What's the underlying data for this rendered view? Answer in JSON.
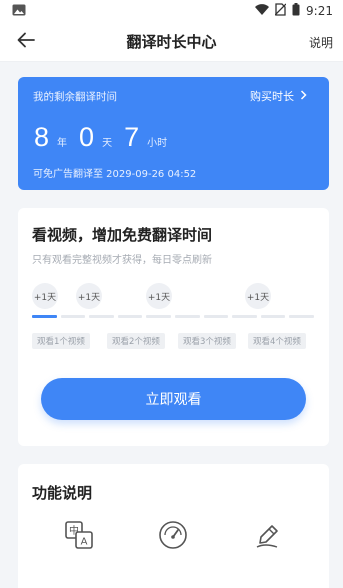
{
  "status_bar": {
    "time": "9:21"
  },
  "header": {
    "title": "翻译时长中心",
    "right_link": "说明"
  },
  "balance_card": {
    "label": "我的剩余翻译时间",
    "buy_label": "购买时长",
    "years_value": "8",
    "years_unit": "年",
    "days_value": "0",
    "days_unit": "天",
    "hours_value": "7",
    "hours_unit": "小时",
    "expiry_text": "可免广告翻译至  2029-09-26 04:52"
  },
  "video_card": {
    "title": "看视频，增加免费翻译时间",
    "subtitle": "只有观看完整视频才获得，每日零点刷新",
    "rewards": [
      "+1天",
      "+1天",
      "+1天",
      "+1天"
    ],
    "progress_fraction": 0.1,
    "steps": [
      "观看1个视频",
      "观看2个视频",
      "观看3个视频",
      "观看4个视频"
    ],
    "watch_button": "立即观看"
  },
  "features": {
    "title": "功能说明",
    "icons": [
      "translate-icon",
      "speedometer-icon",
      "pen-icon"
    ]
  },
  "colors": {
    "accent": "#3f86f6",
    "background": "#f3f5f8"
  }
}
